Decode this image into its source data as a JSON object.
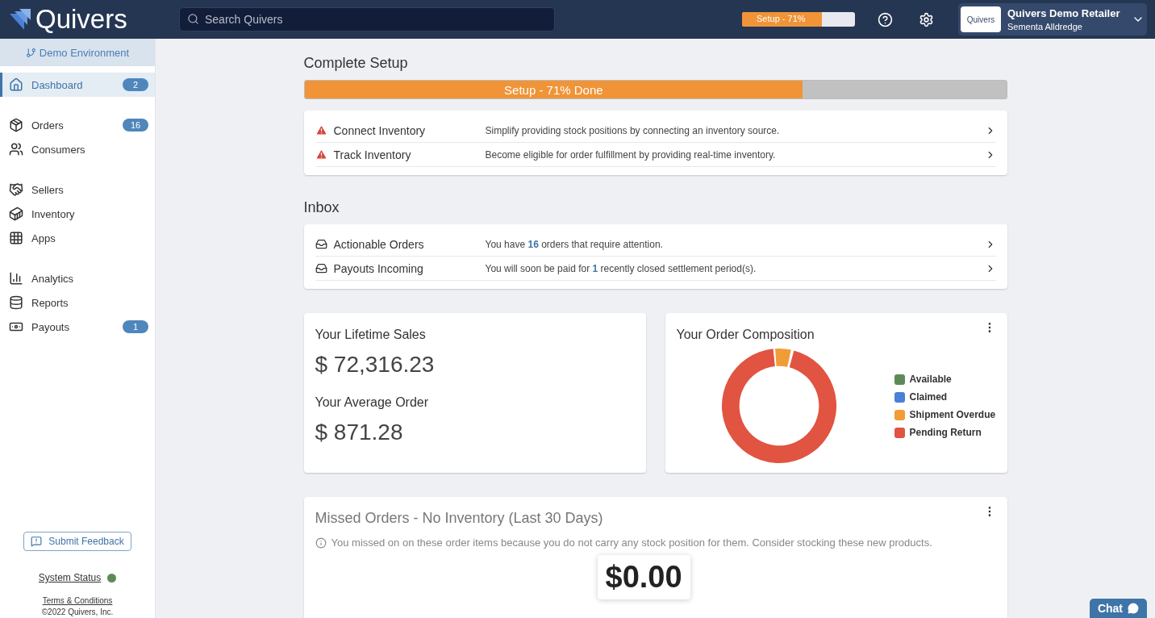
{
  "header": {
    "logo_text": "Quivers",
    "search": {
      "placeholder": "Search Quivers"
    },
    "setup": {
      "label": "Setup - 71%",
      "level": 0.71
    },
    "account": {
      "logo_text": "Quivers",
      "name": "Quivers Demo Retailer",
      "user": "Sementa Alldredge"
    }
  },
  "sidebar": {
    "environment": "Demo Environment",
    "sections": [
      {
        "items": [
          {
            "label": "Dashboard",
            "badge": "2",
            "selected": true
          }
        ]
      },
      {
        "items": [
          {
            "label": "Orders",
            "badge": "16",
            "selected": false
          },
          {
            "label": "Consumers",
            "selected": false
          }
        ]
      },
      {
        "items": [
          {
            "label": "Sellers",
            "selected": false
          },
          {
            "label": "Inventory",
            "selected": false
          },
          {
            "label": "Apps",
            "selected": false
          }
        ]
      },
      {
        "items": [
          {
            "label": "Analytics",
            "selected": false
          },
          {
            "label": "Reports",
            "selected": false
          },
          {
            "label": "Payouts",
            "badge": "1",
            "selected": false
          }
        ]
      }
    ],
    "feedback": "Submit Feedback",
    "system_status": {
      "label": "System Status",
      "color": "#5e8a5a"
    },
    "terms": "Terms & Conditions",
    "copyright": "©2022 Quivers, Inc."
  },
  "setup": {
    "title": "Complete Setup",
    "progress": {
      "label": "Setup - 71% Done",
      "level": 0.71
    },
    "tasks": [
      {
        "title": "Connect Inventory",
        "description": "Simplify providing stock positions by connecting an inventory source."
      },
      {
        "title": "Track Inventory",
        "description": "Become eligible for order fulfillment by providing real-time inventory."
      }
    ]
  },
  "inbox": {
    "title": "Inbox",
    "items": [
      {
        "title": "Actionable Orders",
        "description": "You have **16** orders that require attention."
      },
      {
        "title": "Payouts Incoming",
        "description": "You will soon be paid for **1** recently closed settlement period(s)."
      }
    ]
  },
  "sales": {
    "lifetime_label": "Your Lifetime Sales",
    "lifetime_value": "$ 72,316.23",
    "average_label": "Your Average Order",
    "average_value": "$ 871.28"
  },
  "composition": {
    "title": "Your Order Composition",
    "legend": [
      {
        "label": "Available",
        "color": "#5e8a5a"
      },
      {
        "label": "Claimed",
        "color": "#4a80d6"
      },
      {
        "label": "Shipment Overdue",
        "color": "#f09c37"
      },
      {
        "label": "Pending Return",
        "color": "#e05441"
      }
    ]
  },
  "missed": {
    "title": "Missed Orders - No Inventory (Last 30 Days)",
    "note": "You missed on on these order items because you do not carry any stock position for them. Consider stocking these new products.",
    "tooltip": "$0.00"
  },
  "chat": {
    "label": "Chat"
  }
}
